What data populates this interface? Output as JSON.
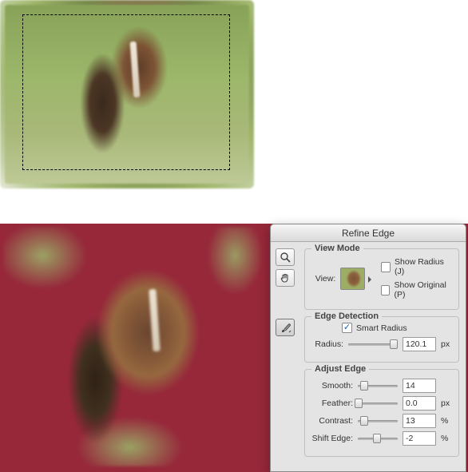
{
  "panel": {
    "title": "Refine Edge",
    "view_mode": {
      "legend": "View Mode",
      "view_label": "View:",
      "show_radius_label": "Show Radius (J)",
      "show_radius_checked": false,
      "show_original_label": "Show Original (P)",
      "show_original_checked": false
    },
    "edge_detection": {
      "legend": "Edge Detection",
      "smart_radius_label": "Smart Radius",
      "smart_radius_checked": true,
      "radius_label": "Radius:",
      "radius_value": "120.1",
      "radius_unit": "px",
      "radius_pct": 92
    },
    "adjust_edge": {
      "legend": "Adjust Edge",
      "smooth_label": "Smooth:",
      "smooth_value": "14",
      "smooth_pct": 16,
      "feather_label": "Feather:",
      "feather_value": "0.0",
      "feather_unit": "px",
      "feather_pct": 2,
      "contrast_label": "Contrast:",
      "contrast_value": "13",
      "contrast_unit": "%",
      "contrast_pct": 15,
      "shift_label": "Shift Edge:",
      "shift_value": "-2",
      "shift_unit": "%",
      "shift_pct": 48
    }
  },
  "tools": {
    "zoom": "zoom-tool",
    "hand": "hand-tool",
    "brush": "refine-radius-brush"
  }
}
